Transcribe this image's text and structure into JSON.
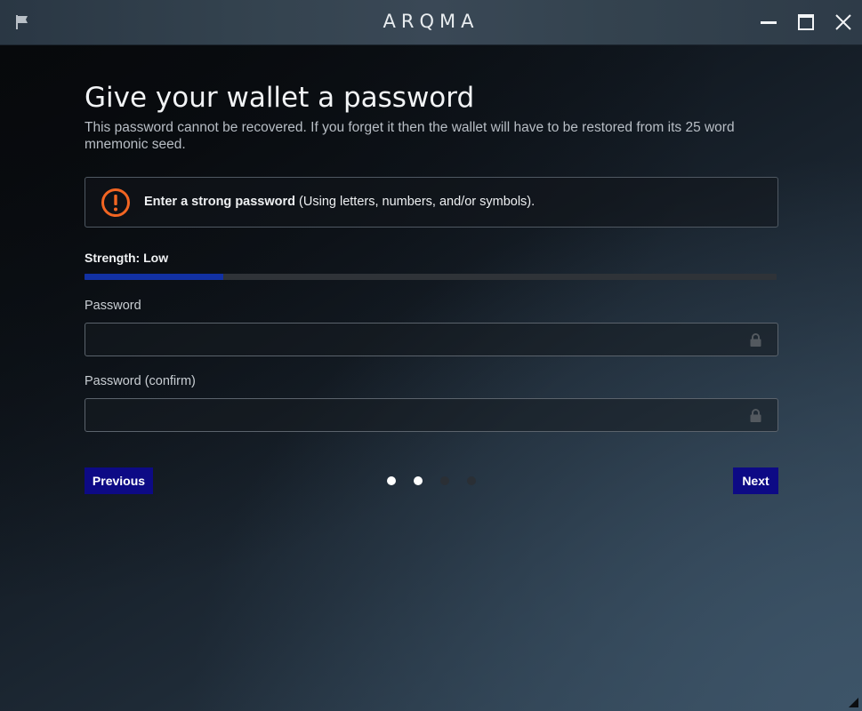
{
  "window": {
    "title": "ARQMA",
    "icons": {
      "flag": "flag-icon",
      "minimize": "minimize-icon",
      "maximize": "maximize-icon",
      "close": "close-icon"
    }
  },
  "page": {
    "title": "Give your wallet a password",
    "description": "This password cannot be recovered. If you forget it then the wallet will have to be restored from its 25 word mnemonic seed."
  },
  "notice": {
    "icon": "warning-icon",
    "icon_color": "#f26522",
    "bold_text": "Enter a strong password",
    "rest_text": " (Using letters, numbers, and/or symbols)."
  },
  "strength": {
    "label": "Strength: Low",
    "level_fraction": 0.2,
    "bar_color": "#1231a3"
  },
  "fields": {
    "password": {
      "label": "Password",
      "value": "",
      "placeholder": ""
    },
    "password_confirm": {
      "label": "Password (confirm)",
      "value": "",
      "placeholder": ""
    }
  },
  "navigation": {
    "previous_label": "Previous",
    "next_label": "Next",
    "step_current": 2,
    "step_total": 4,
    "button_color": "#0d0a85"
  }
}
